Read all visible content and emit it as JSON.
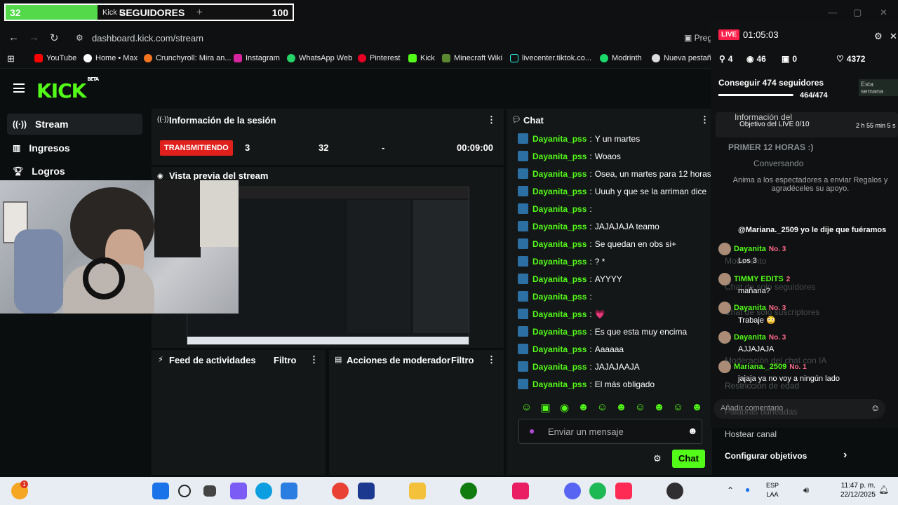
{
  "browser": {
    "goal": {
      "current": "32",
      "label": "SEGUIDORES",
      "max": "100",
      "progress": 0.32,
      "tab_title": "Kick D"
    },
    "url": "dashboard.kick.com/stream",
    "translate_label": "Preguntar a Google",
    "bookmarks": [
      "YouTube",
      "Home • Max",
      "Crunchyroll: Mira an...",
      "Instagram",
      "WhatsApp Web",
      "Pinterest",
      "Kick",
      "Minecraft Wiki",
      "livecenter.tiktok.co...",
      "Modrinth",
      "Nueva pestaña"
    ]
  },
  "sidebar": {
    "items": [
      {
        "label": "Stream",
        "icon": "broadcast-icon"
      },
      {
        "label": "Ingresos",
        "icon": "chart-icon"
      },
      {
        "label": "Logros",
        "icon": "trophy-icon"
      }
    ]
  },
  "session": {
    "title": "Información de la sesión",
    "status": "TRANSMITIENDO",
    "viewers": "3",
    "followers": "32",
    "subs": "-",
    "duration": "00:09:00"
  },
  "preview": {
    "title": "Vista previa del stream"
  },
  "feed": {
    "title": "Feed de actividades",
    "filter": "Filtro"
  },
  "moderator": {
    "title": "Acciones de moderador",
    "filter": "Filtro"
  },
  "chat": {
    "title": "Chat",
    "messages": [
      {
        "user": "Dayanita_pss",
        "text": "Y un martes"
      },
      {
        "user": "Dayanita_pss",
        "text": "Woaos"
      },
      {
        "user": "Dayanita_pss",
        "text": "Osea, un martes para 12 horas"
      },
      {
        "user": "Dayanita_pss",
        "text": "Uuuh y que se la arriman dice"
      },
      {
        "user": "Dayanita_pss",
        "text": ""
      },
      {
        "user": "Dayanita_pss",
        "text": "JAJAJAJA teamo"
      },
      {
        "user": "Dayanita_pss",
        "text": "Se quedan en obs si+"
      },
      {
        "user": "Dayanita_pss",
        "text": "? *"
      },
      {
        "user": "Dayanita_pss",
        "text": "AYYYY"
      },
      {
        "user": "Dayanita_pss",
        "text": ""
      },
      {
        "user": "Dayanita_pss",
        "text": "💗"
      },
      {
        "user": "Dayanita_pss",
        "text": "Es que esta muy encima"
      },
      {
        "user": "Dayanita_pss",
        "text": "Aaaaaa"
      },
      {
        "user": "Dayanita_pss",
        "text": "JAJAJAAJA"
      },
      {
        "user": "Dayanita_pss",
        "text": "El más obligado"
      }
    ],
    "input_placeholder": "Enviar un mensaje",
    "send_label": "Chat"
  },
  "overlay": {
    "live_badge": "LIVE",
    "uptime": "01:05:03",
    "stats": {
      "viewers_a": "4",
      "viewers_b": "46",
      "gifts": "0",
      "likes": "4372"
    },
    "goal_title": "Conseguir 474 seguidores",
    "goal_progress": "464/474",
    "goal_fraction": 0.979,
    "week_label": "Esta semana",
    "session_info": "Información del",
    "live_goal": "Objetivo del LIVE 0/10",
    "time_left": "2 h 55 min 5 s",
    "first_hours": "PRIMER 12 HORAS :)",
    "conversando": "Conversando",
    "invite_text": "Anima a los espectadores a enviar Regalos y agradéceles su apoyo.",
    "comments": [
      {
        "user": "",
        "badge": "",
        "text": "@Mariana._2509 yo le dije que fuéramos"
      },
      {
        "user": "Dayanita",
        "badge": "No. 3",
        "text": "Los 3"
      },
      {
        "user": "TIMMY EDITS",
        "badge": "2",
        "text": "mañana?"
      },
      {
        "user": "Dayanita",
        "badge": "No. 3",
        "text": "Trabaje 😳"
      },
      {
        "user": "Dayanita",
        "badge": "No. 3",
        "text": "AJJAJAJA"
      },
      {
        "user": "Mariana._2509",
        "badge": "No. 1",
        "text": "jajaja ya no voy a ningún lado"
      }
    ],
    "comment_placeholder": "Añadir comentario"
  },
  "settings": {
    "items": [
      "Modo lento",
      "Chat de solo seguidores",
      "Chat de solo suscriptores",
      "Moderación del chat con IA",
      "Restricción de edad",
      "Palabras baneadas",
      "Hostear canal"
    ],
    "configure": "Configurar objetivos"
  },
  "taskbar": {
    "lang": "ESP",
    "region": "LAA",
    "time": "11:47 p. m.",
    "date": "22/12/2025",
    "notification_count": "1"
  }
}
